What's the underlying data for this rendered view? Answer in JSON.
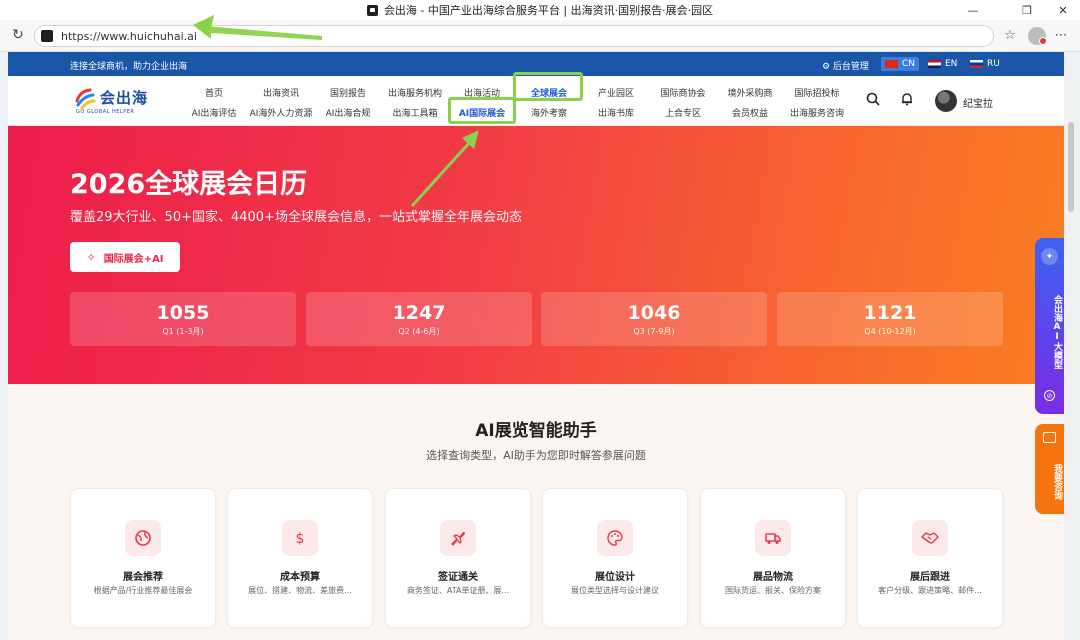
{
  "browser": {
    "window_title": "会出海 - 中国产业出海综合服务平台 | 出海资讯·国别报告·展会·园区",
    "url": "https://www.huichuhai.ai"
  },
  "topbar": {
    "slogan": "连接全球商机，助力企业出海",
    "admin": "⚙ 后台管理",
    "languages": [
      "CN",
      "EN",
      "RU"
    ]
  },
  "logo": {
    "name": "会出海",
    "sub": "GO GLOBAL HELPER"
  },
  "nav": {
    "row1": [
      "首页",
      "出海资讯",
      "国别报告",
      "出海服务机构",
      "出海活动",
      "全球展会",
      "产业园区",
      "国际商协会",
      "境外采购商",
      "国际招投标"
    ],
    "row2": [
      "AI出海评估",
      "AI海外人力资源",
      "AI出海合规",
      "出海工具箱",
      "AI国际展会",
      "海外考察",
      "出海书库",
      "上合专区",
      "会员权益",
      "出海服务咨询"
    ],
    "active": "全球展会",
    "user_name": "纪宝拉"
  },
  "hero": {
    "title": "2026全球展会日历",
    "subtitle": "覆盖29大行业、50+国家、4400+场全球展会信息，一站式掌握全年展会动态",
    "button": "国际展会+AI",
    "quarters": [
      {
        "count": "1055",
        "label": "Q1 (1-3月)"
      },
      {
        "count": "1247",
        "label": "Q2 (4-6月)"
      },
      {
        "count": "1046",
        "label": "Q3 (7-9月)"
      },
      {
        "count": "1121",
        "label": "Q4 (10-12月)"
      }
    ]
  },
  "assistant": {
    "title": "AI展览智能助手",
    "subtitle": "选择查询类型，AI助手为您即时解答参展问题",
    "cards": [
      {
        "icon": "globe-icon",
        "title": "展会推荐",
        "desc": "根据产品/行业推荐最佳展会"
      },
      {
        "icon": "dollar-icon",
        "title": "成本预算",
        "desc": "展位、搭建、物流、差旅费..."
      },
      {
        "icon": "plane-icon",
        "title": "签证通关",
        "desc": "商务签证、ATA单证册、展..."
      },
      {
        "icon": "palette-icon",
        "title": "展位设计",
        "desc": "展位类型选择与设计建议"
      },
      {
        "icon": "truck-icon",
        "title": "展品物流",
        "desc": "国际货运、报关、保险方案"
      },
      {
        "icon": "handshake-icon",
        "title": "展后跟进",
        "desc": "客户分级、跟进策略、邮件..."
      }
    ]
  },
  "side": {
    "ai_tab": "会出海AI大模型",
    "consult_tab": "我要咨询"
  },
  "colors": {
    "brand_blue": "#1a56a8",
    "hero_start": "#ec1d4a",
    "hero_end": "#fb7f22",
    "highlight": "#8bd14a",
    "active_nav": "#1f5bd1"
  }
}
